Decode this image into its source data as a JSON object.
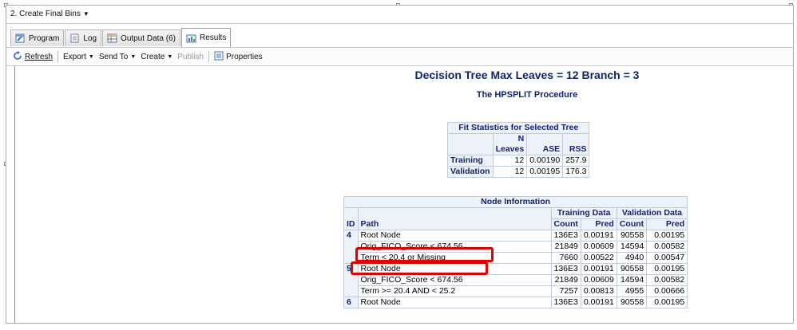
{
  "window": {
    "title": "2. Create Final Bins"
  },
  "tabs": [
    {
      "label": "Program",
      "icon": "program-icon"
    },
    {
      "label": "Log",
      "icon": "log-icon"
    },
    {
      "label": "Output Data (6)",
      "icon": "output-data-icon"
    },
    {
      "label": "Results",
      "icon": "results-icon",
      "active": true
    }
  ],
  "toolbar": {
    "refresh": "Refresh",
    "export": "Export",
    "send_to": "Send To",
    "create": "Create",
    "publish": "Publish",
    "properties": "Properties"
  },
  "report": {
    "title": "Decision Tree Max Leaves = 12 Branch = 3",
    "subtitle": "The HPSPLIT Procedure"
  },
  "fit_stats": {
    "caption": "Fit Statistics for Selected Tree",
    "col_n_line1": "N",
    "col_n_line2": "Leaves",
    "col_ase": "ASE",
    "col_rss": "RSS",
    "rows": [
      {
        "label": "Training",
        "n": "12",
        "ase": "0.00190",
        "rss": "257.9"
      },
      {
        "label": "Validation",
        "n": "12",
        "ase": "0.00195",
        "rss": "176.3"
      }
    ]
  },
  "node_info": {
    "caption": "Node Information",
    "group_training": "Training Data",
    "group_validation": "Validation Data",
    "col_id": "ID",
    "col_path": "Path",
    "col_count": "Count",
    "col_pred": "Pred",
    "rows": [
      {
        "id": "4",
        "path": "Root Node",
        "tc": "136E3",
        "tp": "0.00191",
        "vc": "90558",
        "vp": "0.00195"
      },
      {
        "id": "",
        "path": "Orig_FICO_Score < 674.56",
        "tc": "21849",
        "tp": "0.00609",
        "vc": "14594",
        "vp": "0.00582"
      },
      {
        "id": "",
        "path": "Term < 20.4 or Missing",
        "tc": "7660",
        "tp": "0.00522",
        "vc": "4940",
        "vp": "0.00547"
      },
      {
        "id": "5",
        "path": "Root Node",
        "tc": "136E3",
        "tp": "0.00191",
        "vc": "90558",
        "vp": "0.00195"
      },
      {
        "id": "",
        "path": "Orig_FICO_Score < 674.56",
        "tc": "21849",
        "tp": "0.00609",
        "vc": "14594",
        "vp": "0.00582"
      },
      {
        "id": "",
        "path": "Term >= 20.4 AND < 25.2",
        "tc": "7257",
        "tp": "0.00813",
        "vc": "4955",
        "vp": "0.00666"
      },
      {
        "id": "6",
        "path": "Root Node",
        "tc": "136E3",
        "tp": "0.00191",
        "vc": "90558",
        "vp": "0.00195"
      }
    ]
  },
  "colors": {
    "header_text": "#112277",
    "header_bg": "#edf2f9",
    "highlight": "#e00000"
  }
}
